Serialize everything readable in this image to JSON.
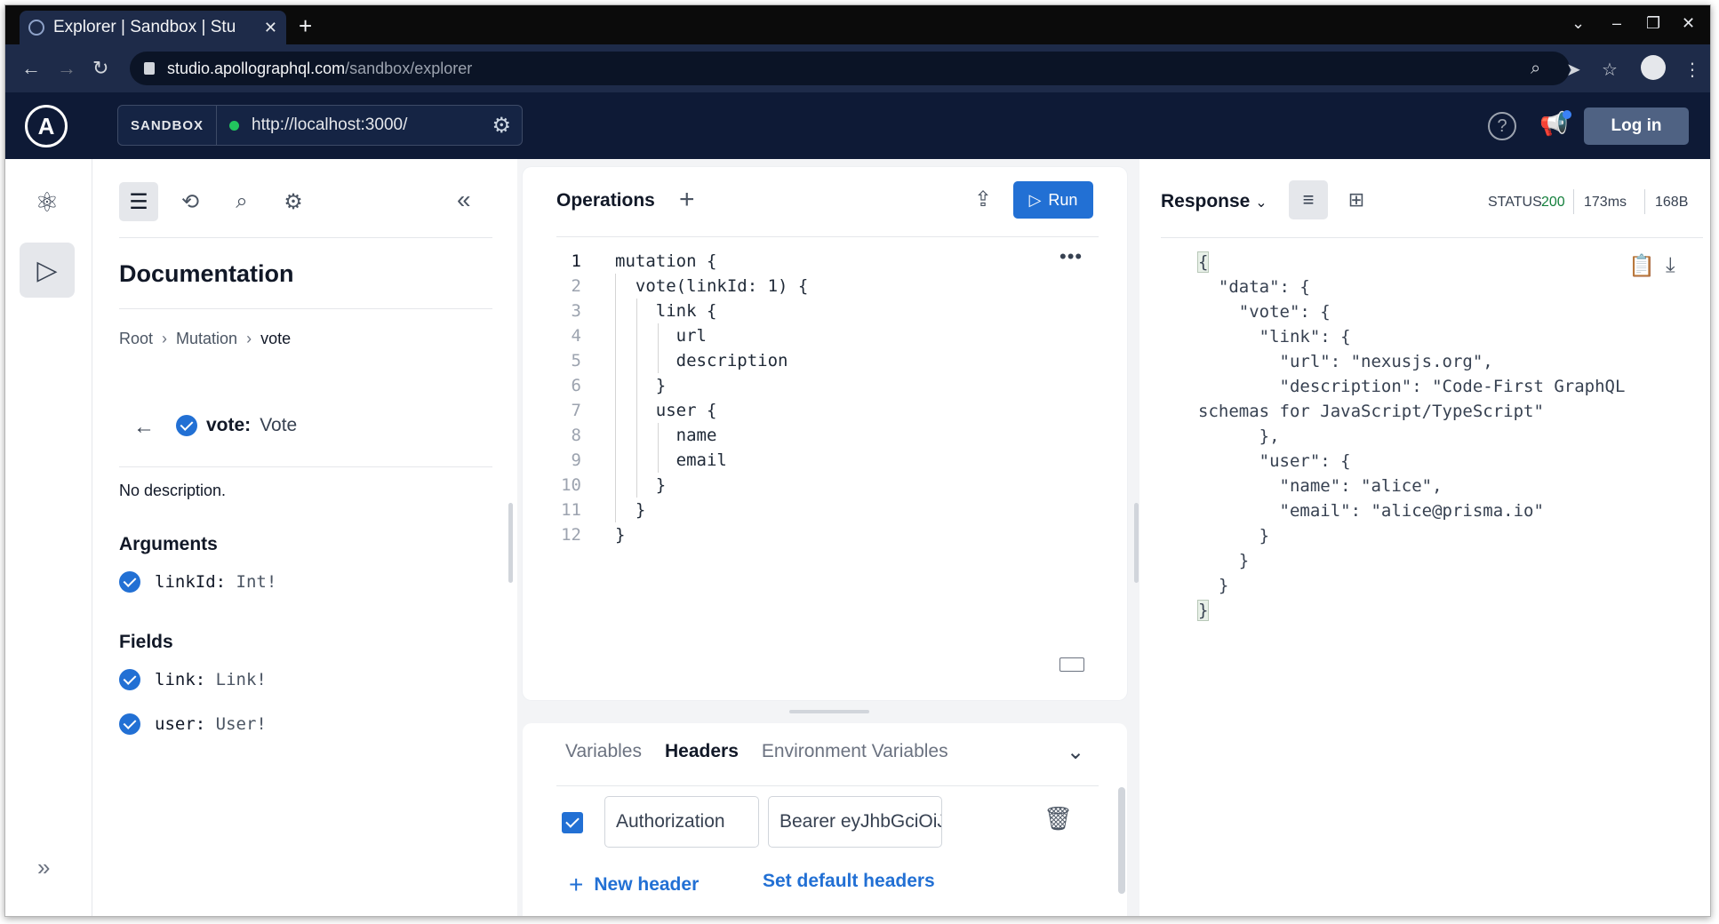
{
  "browser": {
    "tab_title": "Explorer | Sandbox | Stu",
    "tab_close": "✕",
    "new_tab": "+",
    "url_host": "studio.apollographql.com",
    "url_path": "/sandbox/explorer",
    "window_controls": [
      "⌄",
      "–",
      "❐",
      "✕"
    ]
  },
  "header": {
    "logo": "A",
    "sandbox_label": "SANDBOX",
    "endpoint_url": "http://localhost:3000/",
    "status_color": "#22c55e",
    "help": "?",
    "login_label": "Log in"
  },
  "rail": {
    "icons": [
      "schema-icon",
      "explorer-icon"
    ],
    "expand": "»"
  },
  "docs": {
    "title": "Documentation",
    "breadcrumb": [
      "Root",
      "Mutation",
      "vote"
    ],
    "breadcrumb_sep": "›",
    "field_name": "vote:",
    "field_type": "Vote",
    "description": "No description.",
    "arguments_title": "Arguments",
    "arguments": [
      {
        "name": "linkId:",
        "type": "Int!"
      }
    ],
    "fields_title": "Fields",
    "fields": [
      {
        "name": "link:",
        "type": "Link!"
      },
      {
        "name": "user:",
        "type": "User!"
      }
    ],
    "collapse": "«"
  },
  "operations": {
    "title": "Operations",
    "run_label": "Run",
    "line_numbers": [
      "1",
      "2",
      "3",
      "4",
      "5",
      "6",
      "7",
      "8",
      "9",
      "10",
      "11",
      "12"
    ],
    "code_lines": [
      "mutation {",
      "  vote(linkId: 1) {",
      "    link {",
      "      url",
      "      description",
      "    }",
      "    user {",
      "      name",
      "      email",
      "    }",
      "  }",
      "}"
    ],
    "more": "•••"
  },
  "headers_panel": {
    "tabs": [
      "Variables",
      "Headers",
      "Environment Variables"
    ],
    "active_tab": "Headers",
    "header_key": "Authorization",
    "header_value": "Bearer eyJhbGciOiJIU",
    "new_header_label": "New header",
    "set_default_label": "Set default headers"
  },
  "response": {
    "title": "Response",
    "status_label": "STATUS",
    "status_code": "200",
    "time": "173ms",
    "size": "168B",
    "json_lines": [
      "{",
      "  \"data\": {",
      "    \"vote\": {",
      "      \"link\": {",
      "        \"url\": \"nexusjs.org\",",
      "        \"description\": \"Code-First GraphQL",
      "schemas for JavaScript/TypeScript\"",
      "      },",
      "      \"user\": {",
      "        \"name\": \"alice\",",
      "        \"email\": \"alice@prisma.io\"",
      "      }",
      "    }",
      "  }",
      "}"
    ]
  }
}
